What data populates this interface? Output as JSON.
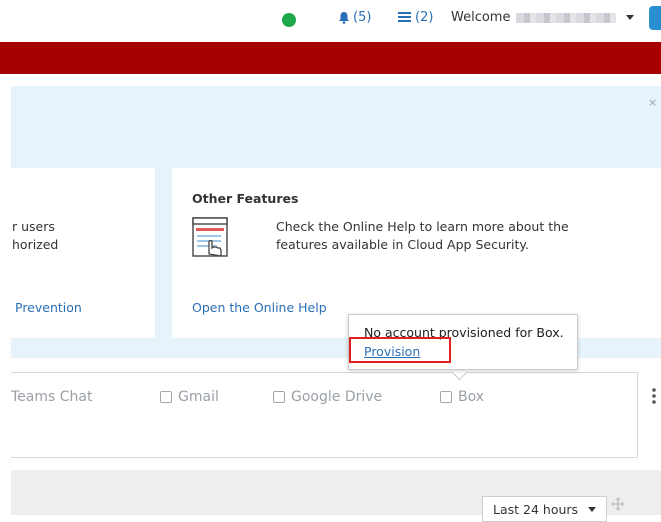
{
  "topbar": {
    "notifications_label": "(5)",
    "tasks_label": "(2)",
    "welcome_label": "Welcome"
  },
  "banner": {
    "close_label": "×"
  },
  "left_card": {
    "line1": "r users",
    "line2": "horized",
    "link": "Prevention"
  },
  "features_card": {
    "title": "Other Features",
    "description": "Check the Online Help to learn more about the features available in Cloud App Security.",
    "link": "Open the Online Help"
  },
  "services": [
    {
      "label": "Teams Chat"
    },
    {
      "label": "Gmail"
    },
    {
      "label": "Google Drive"
    },
    {
      "label": "Box"
    }
  ],
  "tooltip": {
    "message": "No account provisioned for Box.",
    "link": "Provision"
  },
  "filters": {
    "time_range": "Last 24 hours"
  },
  "colors": {
    "brand_red": "#a80000",
    "status_green": "#1ea84a",
    "link_blue": "#2a6fb5",
    "highlight_red": "#e02020"
  }
}
